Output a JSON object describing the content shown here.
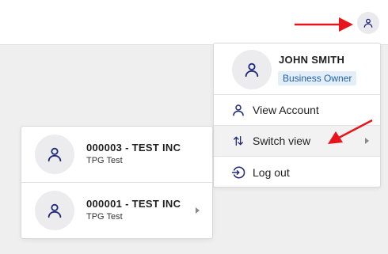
{
  "header": {
    "avatar_icon": "user-icon"
  },
  "user_menu": {
    "name": "JOHN SMITH",
    "role": "Business Owner",
    "items": [
      {
        "label": "View Account",
        "icon": "user-icon"
      },
      {
        "label": "Switch view",
        "icon": "swap-vertical-icon",
        "has_submenu": true,
        "highlighted": true
      },
      {
        "label": "Log out",
        "icon": "logout-icon"
      }
    ]
  },
  "accounts": [
    {
      "name": "000003 - TEST INC",
      "subtitle": "TPG Test"
    },
    {
      "name": "000001 - TEST INC",
      "subtitle": "TPG Test",
      "has_submenu": true
    }
  ],
  "colors": {
    "icon_navy": "#1f2a7a",
    "annotation_arrow": "#e8141b",
    "badge_bg": "#e3eef9",
    "badge_text": "#1f5fa8"
  }
}
